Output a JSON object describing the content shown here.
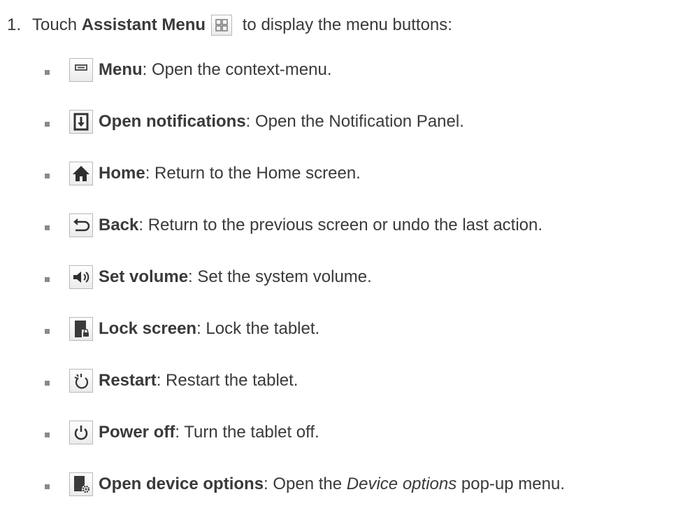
{
  "step": {
    "number": "1.",
    "prefix": "Touch ",
    "bold": "Assistant Menu",
    "icon": "assistant-menu-icon",
    "suffix": " to display the menu buttons:"
  },
  "items": [
    {
      "icon": "menu-icon",
      "bold": "Menu",
      "text": ": Open the context-menu."
    },
    {
      "icon": "notifications-icon",
      "bold": "Open notifications",
      "text": ": Open the Notification Panel."
    },
    {
      "icon": "home-icon",
      "bold": "Home",
      "text": ": Return to the Home screen."
    },
    {
      "icon": "back-icon",
      "bold": "Back",
      "text": ": Return to the previous screen or undo the last action."
    },
    {
      "icon": "volume-icon",
      "bold": "Set volume",
      "text": ": Set the system volume."
    },
    {
      "icon": "lock-screen-icon",
      "bold": "Lock screen",
      "text": ": Lock the tablet."
    },
    {
      "icon": "restart-icon",
      "bold": "Restart",
      "text": ": Restart the tablet."
    },
    {
      "icon": "power-off-icon",
      "bold": "Power off",
      "text": ": Turn the tablet off."
    },
    {
      "icon": "device-options-icon",
      "bold": "Open device options",
      "text": ": Open the ",
      "italic": "Device options",
      "text_after": " pop-up menu."
    }
  ]
}
